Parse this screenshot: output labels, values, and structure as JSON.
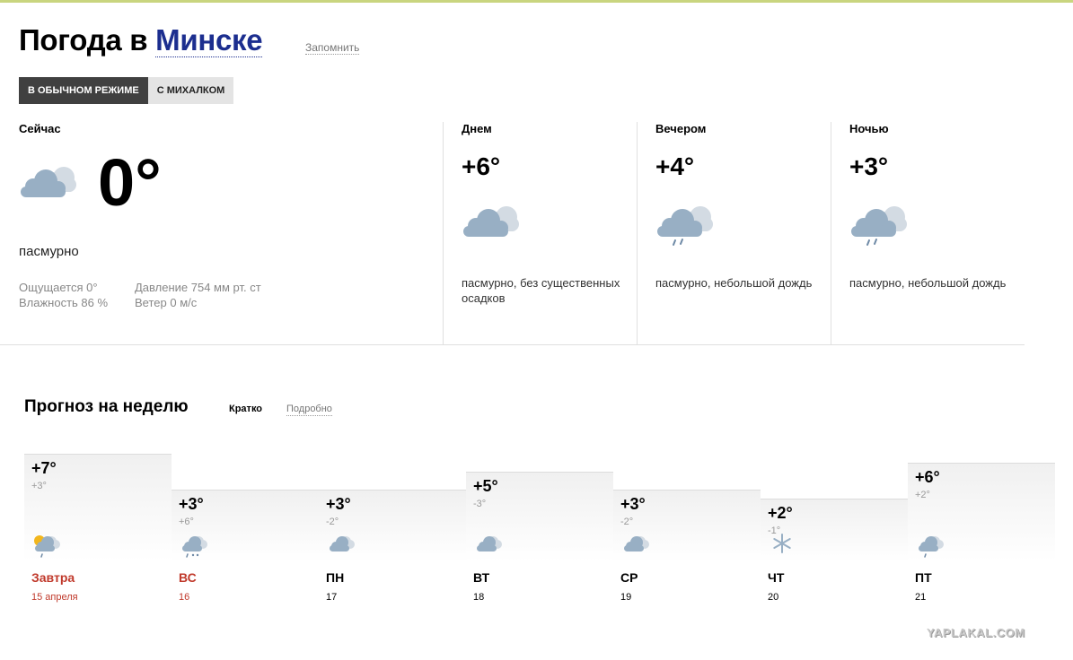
{
  "page": {
    "title_prefix": "Погода в",
    "city": "Минске",
    "remember_link": "Запомнить"
  },
  "modes": [
    {
      "label": "В ОБЫЧНОМ РЕЖИМЕ",
      "active": true
    },
    {
      "label": "С МИХАЛКОМ",
      "active": false
    }
  ],
  "now": {
    "label": "Сейчас",
    "temp": "0°",
    "condition": "пасмурно",
    "feels_like": "Ощущается 0°",
    "humidity": "Влажность 86 %",
    "pressure": "Давление 754 мм рт. ст",
    "wind": "Ветер 0 м/с",
    "icon": "overcast-cloud-icon"
  },
  "parts": [
    {
      "label": "Днем",
      "temp": "+6°",
      "condition": "пасмурно, без существенных осадков",
      "icon": "overcast-cloud-icon"
    },
    {
      "label": "Вечером",
      "temp": "+4°",
      "condition": "пасмурно, небольшой дождь",
      "icon": "light-rain-icon"
    },
    {
      "label": "Ночью",
      "temp": "+3°",
      "condition": "пасмурно, небольшой дождь",
      "icon": "light-rain-icon"
    }
  ],
  "week": {
    "title": "Прогноз на неделю",
    "short_label": "Кратко",
    "detailed_label": "Подробно",
    "days": [
      {
        "name": "Завтра",
        "date": "15 апреля",
        "hi": "+7°",
        "lo": "+3°",
        "icon": "partly-sunny-rain-icon",
        "holiday": true
      },
      {
        "name": "ВС",
        "date": "16",
        "hi": "+3°",
        "lo": "+6°",
        "icon": "snow-rain-icon",
        "holiday": true
      },
      {
        "name": "ПН",
        "date": "17",
        "hi": "+3°",
        "lo": "-2°",
        "icon": "overcast-cloud-icon",
        "holiday": false
      },
      {
        "name": "ВТ",
        "date": "18",
        "hi": "+5°",
        "lo": "-3°",
        "icon": "overcast-cloud-icon",
        "holiday": false
      },
      {
        "name": "СР",
        "date": "19",
        "hi": "+3°",
        "lo": "-2°",
        "icon": "overcast-cloud-icon",
        "holiday": false
      },
      {
        "name": "ЧТ",
        "date": "20",
        "hi": "+2°",
        "lo": "-1°",
        "icon": "snowflake-icon",
        "holiday": false
      },
      {
        "name": "ПТ",
        "date": "21",
        "hi": "+6°",
        "lo": "+2°",
        "icon": "light-rain-icon",
        "holiday": false
      }
    ]
  },
  "watermark": "YAPLAKAL.COM",
  "colors": {
    "city": "#1c2e8f",
    "holiday": "#c0392b",
    "mode_active_bg": "#404040",
    "cloud_front": "#98afc4",
    "cloud_back": "#d3dbe3"
  }
}
